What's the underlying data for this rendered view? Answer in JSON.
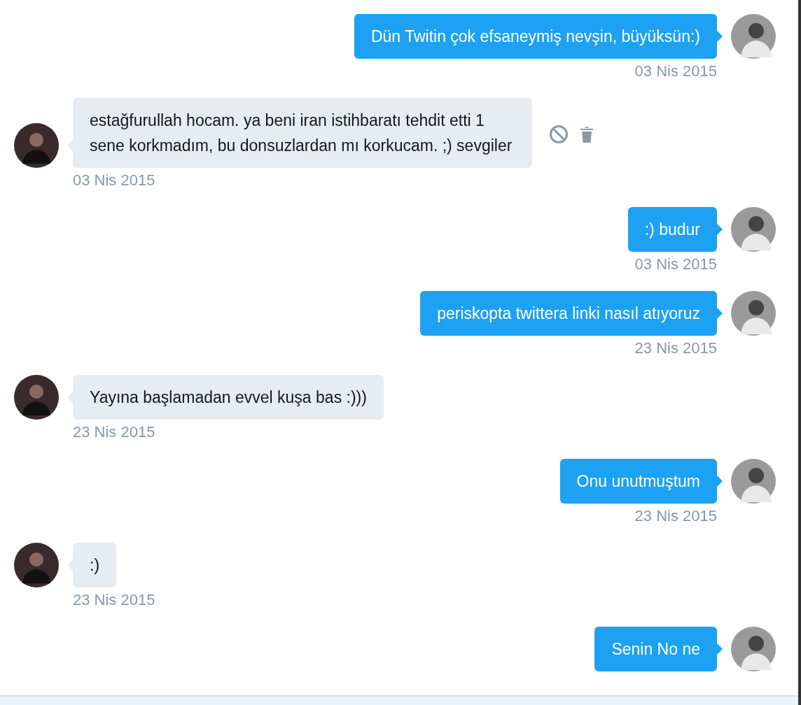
{
  "messages": [
    {
      "kind": "sent",
      "text": "Dün Twitin çok efsaneymiş nevşin, büyüksün:)",
      "timestamp": "03 Nis 2015",
      "actions_shown": false
    },
    {
      "kind": "received",
      "text": "estağfurullah hocam. ya beni iran istihbaratı tehdit etti 1 sene korkmadım, bu donsuzlardan mı korkucam. ;) sevgiler",
      "timestamp": "03 Nis 2015",
      "actions_shown": true
    },
    {
      "kind": "sent",
      "text": ":) budur",
      "timestamp": "03 Nis 2015",
      "actions_shown": false
    },
    {
      "kind": "sent",
      "text": "periskopta twittera linki nasıl atıyoruz",
      "timestamp": "23 Nis 2015",
      "actions_shown": false
    },
    {
      "kind": "received",
      "text": "Yayına başlamadan evvel kuşa bas :)))",
      "timestamp": "23 Nis 2015",
      "actions_shown": false
    },
    {
      "kind": "sent",
      "text": "Onu unutmuştum",
      "timestamp": "23 Nis 2015",
      "actions_shown": false
    },
    {
      "kind": "received",
      "text": ":)",
      "timestamp": "23 Nis 2015",
      "actions_shown": false
    },
    {
      "kind": "sent",
      "text": "Senin No ne",
      "actions_shown": false
    }
  ]
}
